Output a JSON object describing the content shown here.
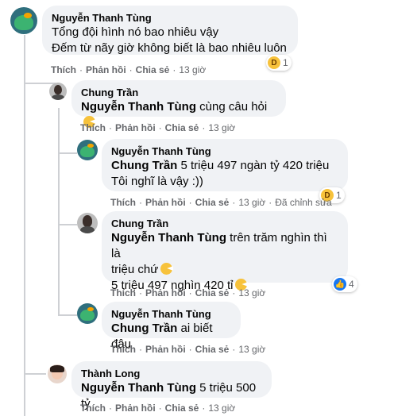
{
  "comments": [
    {
      "author": "Nguyễn Thanh Tùng",
      "line1": "Tổng đội hình nó bao nhiêu vậy",
      "line2": "Đếm từ nãy giờ không biết là bao nhiêu luôn",
      "actions": {
        "like": "Thích",
        "reply": "Phản hồi",
        "share": "Chia sẻ",
        "time": "13 giờ"
      },
      "reaction": {
        "icon": "haha-icon",
        "count": "1"
      }
    },
    {
      "author": "Chung Trần",
      "mention": "Nguyễn Thanh Tùng",
      "text": "cùng câu hỏi",
      "actions": {
        "like": "Thích",
        "reply": "Phản hồi",
        "share": "Chia sẻ",
        "time": "13 giờ"
      }
    },
    {
      "author": "Nguyễn Thanh Tùng",
      "mention": "Chung Trần",
      "text": "5 triệu 497 ngàn tỷ 420 triệu",
      "line2": "Tôi nghĩ là vậy :))",
      "actions": {
        "like": "Thích",
        "reply": "Phản hồi",
        "share": "Chia sẻ",
        "time": "13 giờ",
        "edited": "Đã chỉnh sửa"
      },
      "reaction": {
        "icon": "haha-icon",
        "count": "1"
      }
    },
    {
      "author": "Chung Trần",
      "mention": "Nguyễn Thanh Tùng",
      "text": "trên trăm nghìn thì là",
      "line2": "triệu chứ",
      "line3": "5 triệu 497 nghìn 420 tỉ",
      "actions": {
        "like": "Thích",
        "reply": "Phản hồi",
        "share": "Chia sẻ",
        "time": "13 giờ"
      },
      "reaction": {
        "icon": "like-icon",
        "count": "4"
      }
    },
    {
      "author": "Nguyễn Thanh Tùng",
      "mention": "Chung Trần",
      "text": "ai biết đâu",
      "actions": {
        "like": "Thích",
        "reply": "Phản hồi",
        "share": "Chia sẻ",
        "time": "13 giờ"
      }
    },
    {
      "author": "Thành Long",
      "mention": "Nguyễn Thanh Tùng",
      "text": "5 triệu 500 tỷ",
      "actions": {
        "like": "Thích",
        "reply": "Phản hồi",
        "share": "Chia sẻ",
        "time": "13 giờ"
      }
    }
  ],
  "colors": {
    "bubble": "#f0f2f5",
    "meta": "#65676b",
    "like": "#1877f2",
    "haha": "#f7c23b"
  }
}
